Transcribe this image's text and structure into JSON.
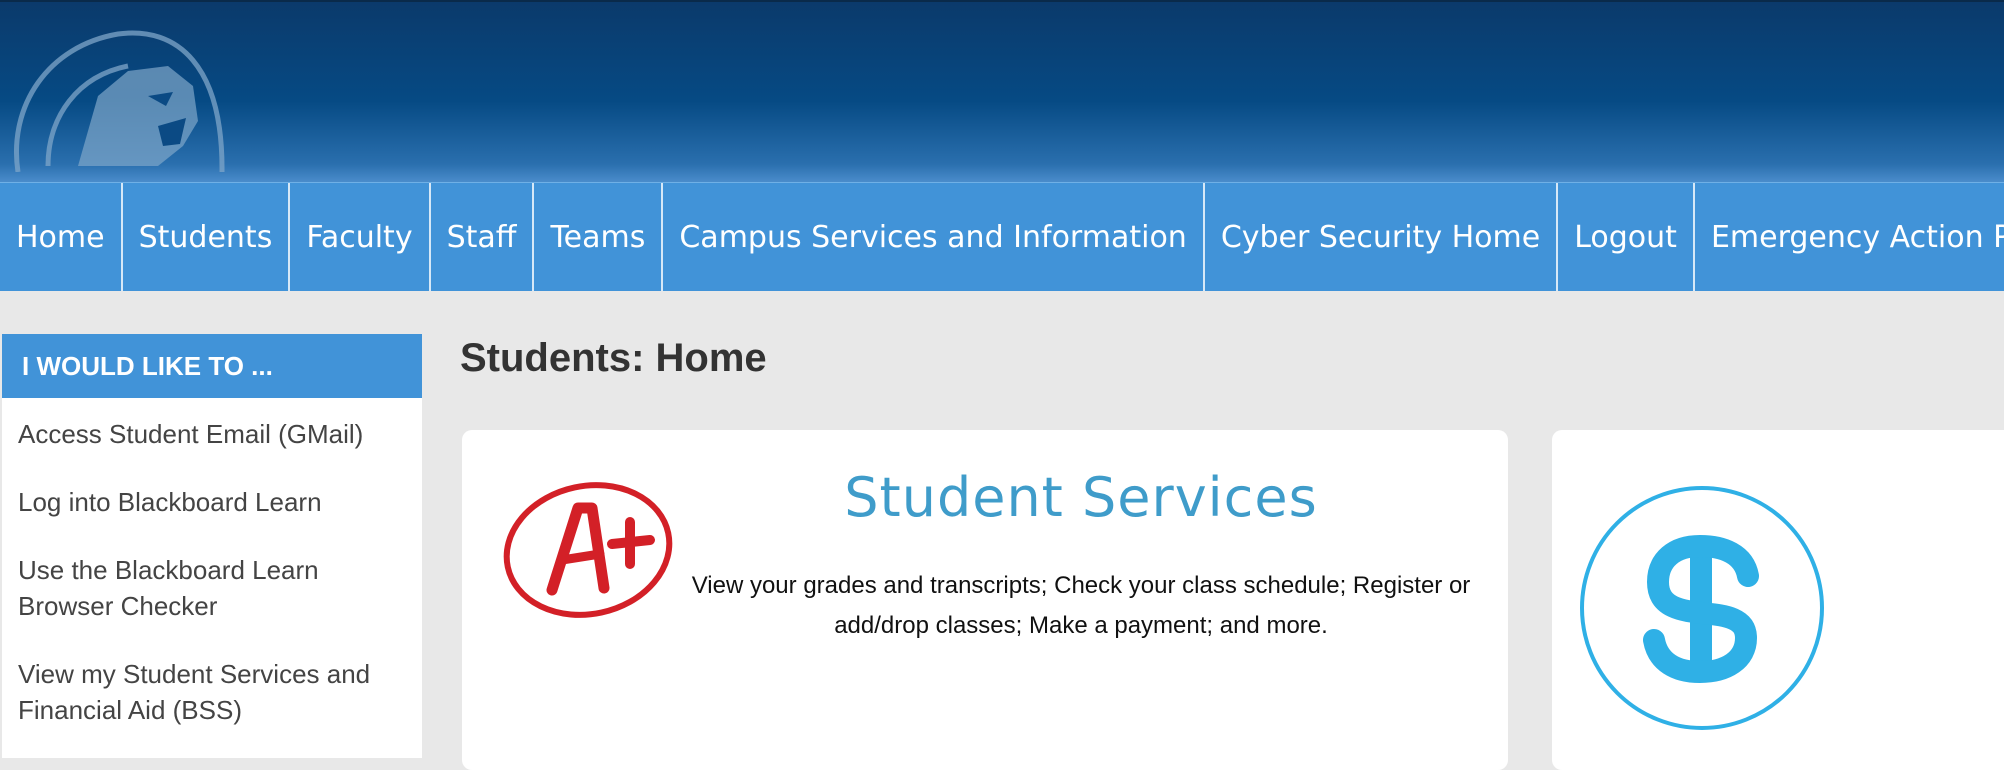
{
  "nav": {
    "items": [
      {
        "label": "Home"
      },
      {
        "label": "Students"
      },
      {
        "label": "Faculty"
      },
      {
        "label": "Staff"
      },
      {
        "label": "Teams"
      },
      {
        "label": "Campus Services and Information"
      },
      {
        "label": "Cyber Security Home"
      },
      {
        "label": "Logout"
      },
      {
        "label": "Emergency Action Plan"
      }
    ]
  },
  "sidebar": {
    "title": "I WOULD LIKE TO ...",
    "links": [
      {
        "label": "Access Student Email (GMail)"
      },
      {
        "label": "Log into Blackboard Learn"
      },
      {
        "label": "Use the Blackboard Learn Browser Checker"
      },
      {
        "label": "View my Student Services and Financial Aid (BSS)"
      }
    ]
  },
  "main": {
    "page_title": "Students: Home",
    "cards": [
      {
        "icon": "grade-a-plus-icon",
        "title": "Student Services",
        "description": "View your grades and transcripts; Check your class schedule; Register or add/drop classes; Make a payment; and more."
      },
      {
        "icon": "dollar-icon"
      }
    ]
  },
  "colors": {
    "header_dark": "#064a84",
    "nav_blue": "#4193d8",
    "accent_teal": "#3f9cca",
    "dollar_blue": "#2fb0e6",
    "grade_red": "#d32027",
    "page_bg": "#e8e8e8"
  }
}
